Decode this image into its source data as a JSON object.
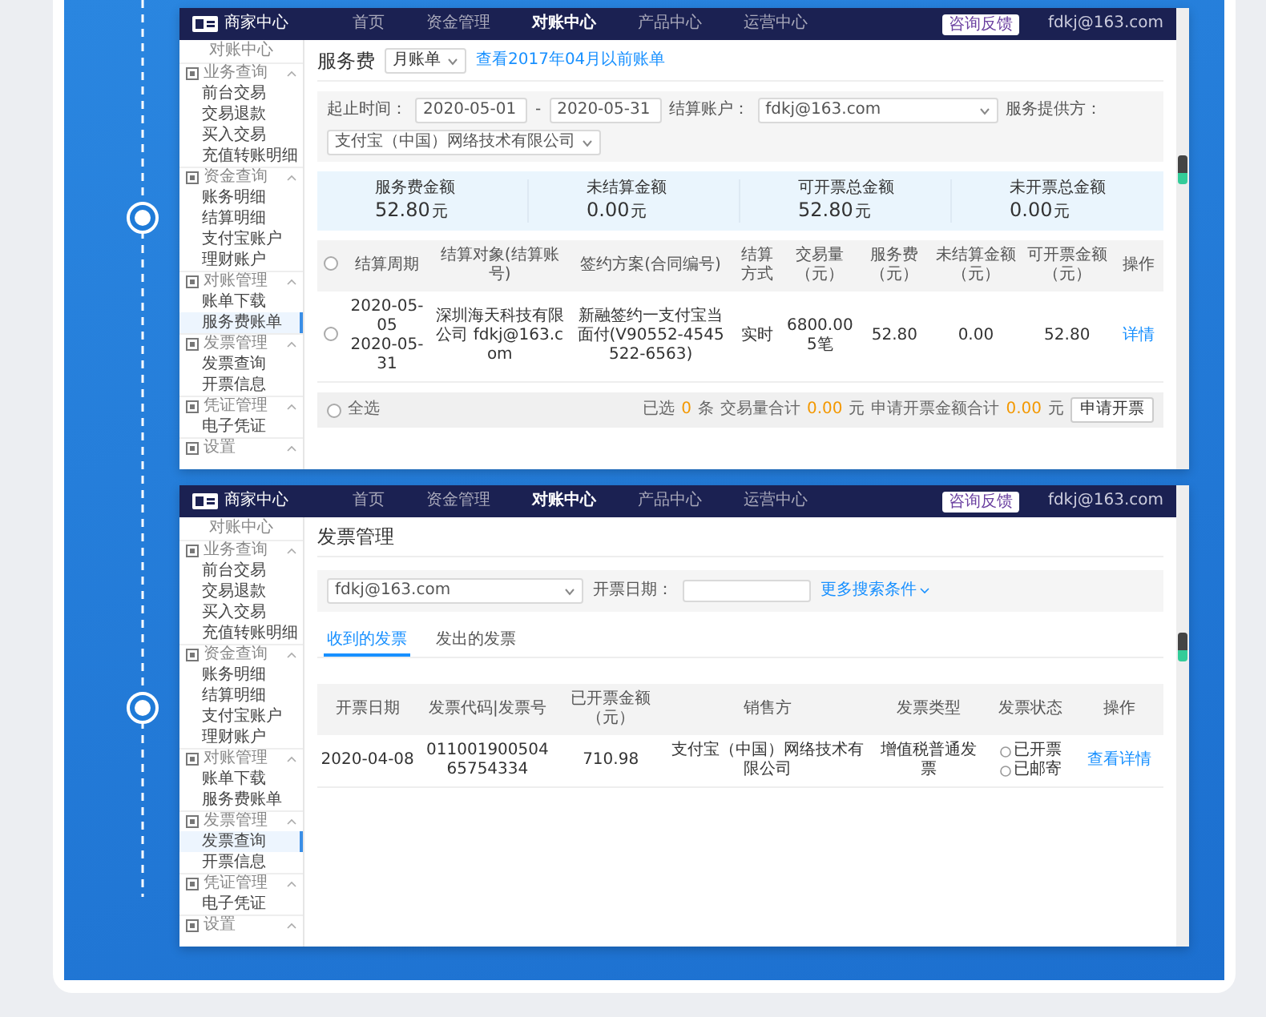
{
  "screens": [
    {
      "kind": "service_fee",
      "logo_text": "商家中心",
      "nav": [
        {
          "label": "首页",
          "selected": false
        },
        {
          "label": "资金管理",
          "selected": false
        },
        {
          "label": "对账中心",
          "selected": true
        },
        {
          "label": "产品中心",
          "selected": false
        },
        {
          "label": "运营中心",
          "selected": false
        }
      ],
      "feedback_button": "咨询反馈",
      "user": "fdkj@163.com",
      "sidebar": {
        "title": "对账中心",
        "groups": [
          {
            "label": "业务查询",
            "items": [
              {
                "label": "前台交易",
                "selected": false
              },
              {
                "label": "交易退款",
                "selected": false
              },
              {
                "label": "买入交易",
                "selected": false
              },
              {
                "label": "充值转账明细",
                "selected": false
              }
            ]
          },
          {
            "label": "资金查询",
            "items": [
              {
                "label": "账务明细",
                "selected": false
              },
              {
                "label": "结算明细",
                "selected": false
              },
              {
                "label": "支付宝账户",
                "selected": false
              },
              {
                "label": "理财账户",
                "selected": false
              }
            ]
          },
          {
            "label": "对账管理",
            "items": [
              {
                "label": "账单下载",
                "selected": false
              },
              {
                "label": "服务费账单",
                "selected": true
              }
            ]
          },
          {
            "label": "发票管理",
            "items": [
              {
                "label": "发票查询",
                "selected": false
              },
              {
                "label": "开票信息",
                "selected": false
              }
            ]
          },
          {
            "label": "凭证管理",
            "items": [
              {
                "label": "电子凭证",
                "selected": false
              }
            ]
          },
          {
            "label": "设置"
          }
        ]
      },
      "page": {
        "title": "服务费",
        "period_select": "月账单",
        "history_link": "查看2017年04月以前账单",
        "filters": {
          "date_label": "起止时间：",
          "date_from": "2020-05-01",
          "date_sep": "-",
          "date_to": "2020-05-31",
          "account_label": "结算账户：",
          "account": "fdkj@163.com",
          "provider_label": "服务提供方：",
          "provider": "支付宝（中国）网络技术有限公司"
        },
        "summary": [
          {
            "label": "服务费金额",
            "amount": "52.80",
            "unit": "元"
          },
          {
            "label": "未结算金额",
            "amount": "0.00",
            "unit": "元"
          },
          {
            "label": "可开票总金额",
            "amount": "52.80",
            "unit": "元"
          },
          {
            "label": "未开票总金额",
            "amount": "0.00",
            "unit": "元"
          }
        ],
        "table": {
          "header_checked": false,
          "columns": [
            "结算周期",
            "结算对象(结算账号)",
            "签约方案(合同编号)",
            "结算方式",
            "交易量（元）",
            "服务费（元）",
            "未结算金额（元）",
            "可开票金额（元）",
            "操作"
          ],
          "rows": [
            {
              "checked": false,
              "cells": [
                [
                  "2020-05-05",
                  "2020-05-31"
                ],
                [
                  "深圳海天科技有限公司 fdkj@163.com"
                ],
                [
                  "新融签约一支付宝当面付(V90552-4545522-6563)"
                ],
                [
                  "实时"
                ],
                [
                  "6800.00",
                  "5笔"
                ],
                [
                  "52.80"
                ],
                [
                  "0.00"
                ],
                [
                  "52.80"
                ]
              ],
              "action": "详情"
            }
          ]
        },
        "footer": {
          "select_all": "全选",
          "select_all_checked": false,
          "selected_prefix": "已选",
          "selected_count": "0",
          "selected_suffix": "条",
          "volume_label": "交易量合计",
          "volume": "0.00",
          "volume_unit": "元",
          "apply_label": "申请开票金额合计",
          "apply": "0.00",
          "apply_unit": "元",
          "apply_button": "申请开票"
        }
      }
    },
    {
      "kind": "invoice",
      "logo_text": "商家中心",
      "nav": [
        {
          "label": "首页",
          "selected": false
        },
        {
          "label": "资金管理",
          "selected": false
        },
        {
          "label": "对账中心",
          "selected": true
        },
        {
          "label": "产品中心",
          "selected": false
        },
        {
          "label": "运营中心",
          "selected": false
        }
      ],
      "feedback_button": "咨询反馈",
      "user": "fdkj@163.com",
      "sidebar": {
        "title": "对账中心",
        "groups": [
          {
            "label": "业务查询",
            "items": [
              {
                "label": "前台交易",
                "selected": false
              },
              {
                "label": "交易退款",
                "selected": false
              },
              {
                "label": "买入交易",
                "selected": false
              },
              {
                "label": "充值转账明细",
                "selected": false
              }
            ]
          },
          {
            "label": "资金查询",
            "items": [
              {
                "label": "账务明细",
                "selected": false
              },
              {
                "label": "结算明细",
                "selected": false
              },
              {
                "label": "支付宝账户",
                "selected": false
              },
              {
                "label": "理财账户",
                "selected": false
              }
            ]
          },
          {
            "label": "对账管理",
            "items": [
              {
                "label": "账单下载",
                "selected": false
              },
              {
                "label": "服务费账单",
                "selected": false
              }
            ]
          },
          {
            "label": "发票管理",
            "items": [
              {
                "label": "发票查询",
                "selected": true
              },
              {
                "label": "开票信息",
                "selected": false
              }
            ]
          },
          {
            "label": "凭证管理",
            "items": [
              {
                "label": "电子凭证",
                "selected": false
              }
            ]
          },
          {
            "label": "设置"
          }
        ]
      },
      "page": {
        "title": "发票管理",
        "account_select": "fdkj@163.com",
        "date_label": "开票日期：",
        "more_link": "更多搜索条件",
        "tabs": [
          {
            "label": "收到的发票",
            "selected": true
          },
          {
            "label": "发出的发票",
            "selected": false
          }
        ],
        "table": {
          "columns": [
            "开票日期",
            "发票代码|发票号",
            "已开票金额（元）",
            "销售方",
            "发票类型",
            "发票状态",
            "操作"
          ],
          "rows": [
            {
              "cells": [
                [
                  "2020-04-08"
                ],
                [
                  "011001900504",
                  "65754334"
                ],
                [
                  "710.98"
                ],
                [
                  "支付宝（中国）网络技术有限公司"
                ],
                [
                  "增值税普通发票"
                ]
              ],
              "status": [
                "已开票",
                "已邮寄"
              ],
              "action": "查看详情"
            }
          ]
        }
      }
    }
  ]
}
